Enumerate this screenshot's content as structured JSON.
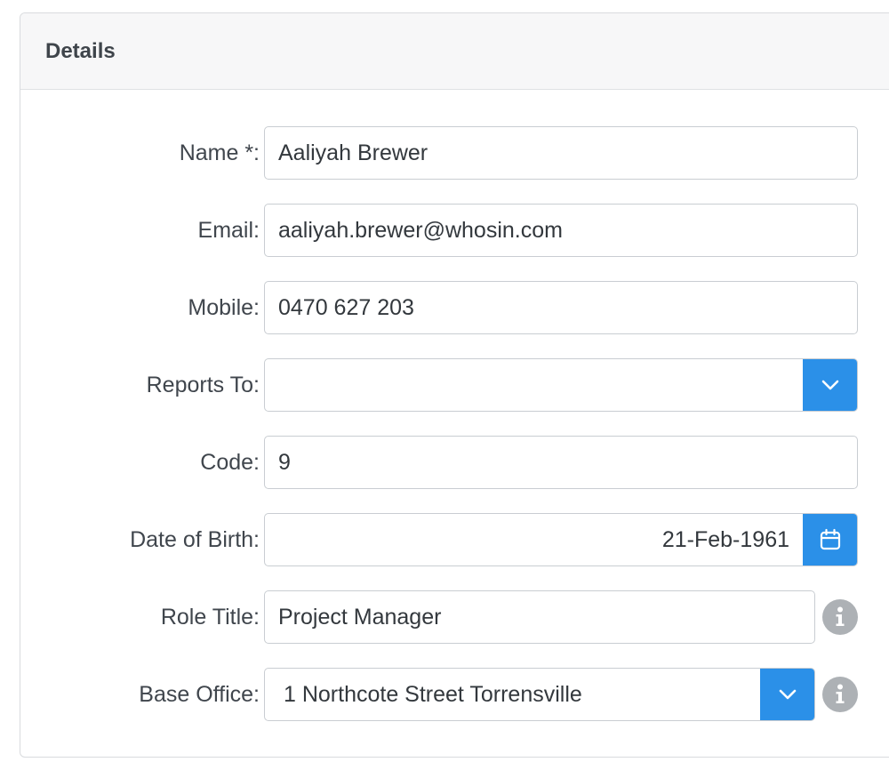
{
  "card": {
    "title": "Details"
  },
  "fields": {
    "name": {
      "label": "Name *:",
      "value": "Aaliyah Brewer"
    },
    "email": {
      "label": "Email:",
      "value": "aaliyah.brewer@whosin.com"
    },
    "mobile": {
      "label": "Mobile:",
      "value": "0470 627 203"
    },
    "reports_to": {
      "label": "Reports To:",
      "value": ""
    },
    "code": {
      "label": "Code:",
      "value": "9"
    },
    "date_of_birth": {
      "label": "Date of Birth:",
      "value": "21-Feb-1961"
    },
    "role_title": {
      "label": "Role Title:",
      "value": "Project Manager"
    },
    "base_office": {
      "label": "Base Office:",
      "value": "1 Northcote Street Torrensville"
    }
  },
  "icons": {
    "dropdown": "chevron-down-icon",
    "calendar": "calendar-icon",
    "info": "info-icon"
  },
  "colors": {
    "accent": "#2b90e8",
    "info_icon": "#adb1b5",
    "header_bg": "#f7f7f8"
  }
}
